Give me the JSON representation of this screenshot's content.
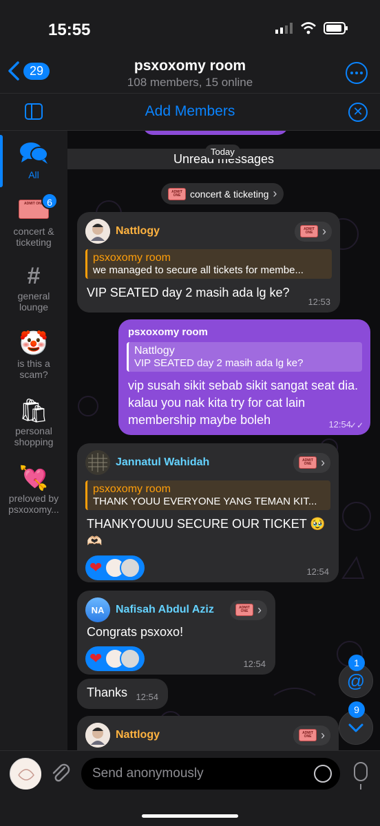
{
  "status": {
    "time": "15:55"
  },
  "header": {
    "back_count": "29",
    "title": "psxoxomy room",
    "subtitle": "108 members, 15 online"
  },
  "add_bar": {
    "label": "Add Members"
  },
  "sidebar": {
    "items": [
      {
        "label": "All",
        "icon": "chat-bubbles-icon"
      },
      {
        "label": "concert & ticketing",
        "badge": "6",
        "icon": "ticket-icon"
      },
      {
        "label": "general lounge",
        "icon": "hash-icon"
      },
      {
        "label": "is this a scam?",
        "icon": "clown-icon"
      },
      {
        "label": "personal shopping",
        "icon": "shopping-bags-icon"
      },
      {
        "label": "preloved by psxoxomy...",
        "icon": "heart-arrow-icon"
      }
    ]
  },
  "chat": {
    "unread_label": "Unread messages",
    "today_label": "Today",
    "topic_pill": "concert & ticketing",
    "messages": [
      {
        "sender": "Nattlogy",
        "reply_title": "psxoxomy room",
        "reply_text": "we managed to secure all tickets for membe...",
        "text": "VIP SEATED day 2 masih ada lg ke?",
        "time": "12:53"
      },
      {
        "sender": "psxoxomy room",
        "reply_title": "Nattlogy",
        "reply_text": "VIP SEATED day 2 masih ada lg ke?",
        "text": "vip susah sikit sebab sikit sangat seat dia. kalau you nak kita try for cat lain membership maybe boleh",
        "time": "12:54"
      },
      {
        "sender": "Jannatul Wahidah",
        "reply_title": "psxoxomy room",
        "reply_text": "THANK YOUU EVERYONE YANG TEMAN KIT...",
        "text": "THANKYOUUU SECURE OUR TICKET 🥹🫶🏻",
        "time": "12:54"
      },
      {
        "sender": "Nafisah Abdul Aziz",
        "avatar_initials": "NA",
        "text": "Congrats psxoxo!",
        "time": "12:54"
      },
      {
        "text": "Thanks",
        "time": "12:54"
      },
      {
        "sender": "Nattlogy"
      }
    ]
  },
  "fabs": {
    "mention_badge": "1",
    "down_badge": "9"
  },
  "input": {
    "placeholder": "Send anonymously"
  },
  "colors": {
    "accent": "#0a84ff",
    "outgoing": "#8b4bd8",
    "incoming": "#2c2c2e"
  }
}
